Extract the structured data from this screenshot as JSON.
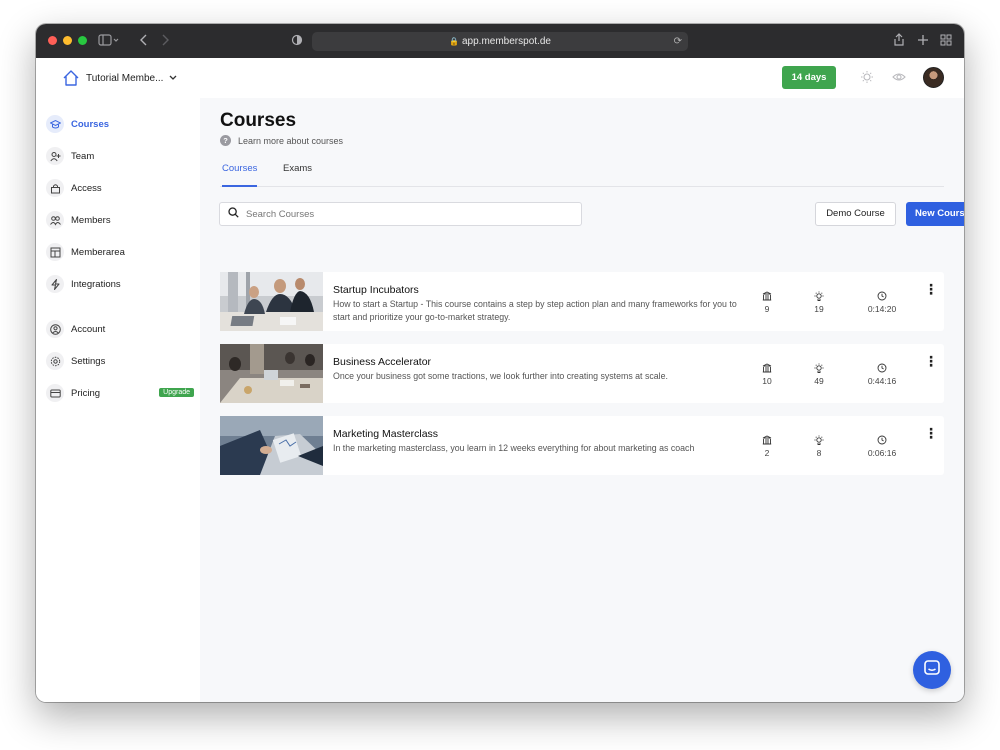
{
  "browser": {
    "url": "app.memberspot.de",
    "traffic_lights": [
      "#ff5f57",
      "#febc2e",
      "#28c840"
    ]
  },
  "header": {
    "workspace_name": "Tutorial Membe...",
    "trial_label": "14 days",
    "trial_color": "#3fa54e"
  },
  "sidebar": {
    "items": [
      {
        "label": "Courses",
        "icon": "graduation-cap-icon",
        "active": true
      },
      {
        "label": "Team",
        "icon": "user-plus-icon",
        "active": false
      },
      {
        "label": "Access",
        "icon": "lock-icon",
        "active": false
      },
      {
        "label": "Members",
        "icon": "users-icon",
        "active": false
      },
      {
        "label": "Memberarea",
        "icon": "layout-icon",
        "active": false
      },
      {
        "label": "Integrations",
        "icon": "bolt-icon",
        "active": false
      },
      {
        "label": "Account",
        "icon": "user-circle-icon",
        "active": false
      },
      {
        "label": "Settings",
        "icon": "gear-icon",
        "active": false
      },
      {
        "label": "Pricing",
        "icon": "credit-card-icon",
        "active": false
      }
    ],
    "upgrade_badge": "Upgrade"
  },
  "main": {
    "title": "Courses",
    "help_text": "Learn more about courses",
    "tabs": [
      {
        "label": "Courses",
        "active": true
      },
      {
        "label": "Exams",
        "active": false
      }
    ],
    "search_placeholder": "Search Courses",
    "demo_button": "Demo Course",
    "new_button": "New Course",
    "accent_color": "#2f60e0",
    "courses": [
      {
        "title": "Startup Incubators",
        "description": "How to start a Startup - This course contains a step by step action plan and many frameworks for you to start and prioritize your go-to-market strategy.",
        "modules": "9",
        "lessons": "19",
        "duration": "0:14:20"
      },
      {
        "title": "Business Accelerator",
        "description": "Once your business got some tractions, we look further into creating systems at scale.",
        "modules": "10",
        "lessons": "49",
        "duration": "0:44:16"
      },
      {
        "title": "Marketing Masterclass",
        "description": "In the marketing masterclass, you learn in 12 weeks everything for about marketing as coach",
        "modules": "2",
        "lessons": "8",
        "duration": "0:06:16"
      }
    ]
  }
}
